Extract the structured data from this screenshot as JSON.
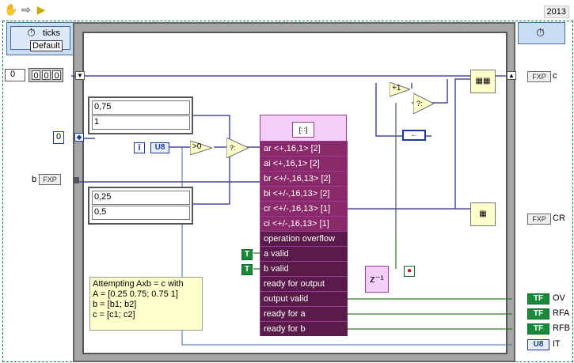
{
  "year": "2013",
  "ticks_label": "ticks",
  "ticks_default": "Default",
  "zero_ctl": "0",
  "array_idx": [
    "0",
    "0",
    "0"
  ],
  "const_a": [
    "0,75",
    "1"
  ],
  "const_b": [
    "0,25",
    "0,5"
  ],
  "num_zero": "0",
  "iter": "i",
  "u8": "U8",
  "gt0": ">0",
  "b_label": "b",
  "fxp": "FXP",
  "c_label": "c",
  "cr_label": "CR",
  "ov_label": "OV",
  "rfa_label": "RFA",
  "rfb_label": "RFB",
  "it_label": "IT",
  "tf": "TF",
  "t": "T",
  "node_rows": [
    "ar <+,16,1> [2]",
    "ai <+,16,1> [2]",
    "br <+/-,16,13> [2]",
    "bi <+/-,16,13> [2]",
    "cr <+/-,16,13> [1]",
    "ci <+/-,16,13> [1]",
    "operation overflow",
    "a valid",
    "b valid",
    "ready for output",
    "output valid",
    "ready for a",
    "ready for b"
  ],
  "note": [
    "Attempting Axb = c with",
    "A = [0.25 0.75; 0.75 1]",
    "b = [b1; b2]",
    "c = [c1; c2]"
  ],
  "z_inv": "z⁻¹",
  "plus1": "+1"
}
